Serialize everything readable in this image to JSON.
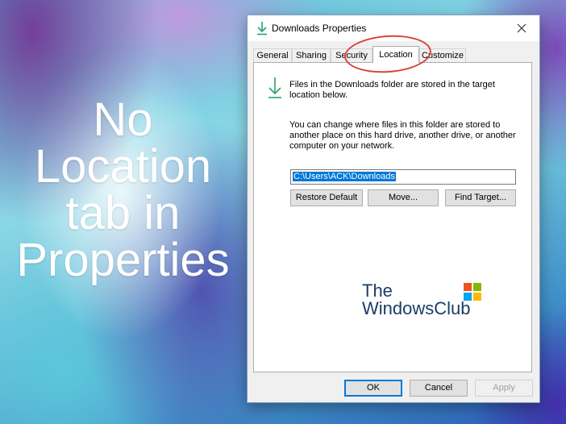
{
  "overlay_text": {
    "line1": "No",
    "line2": "Location",
    "line3": "tab in",
    "line4": "Properties"
  },
  "dialog": {
    "title": "Downloads Properties",
    "close_label": "✕",
    "tabs": [
      {
        "label": "General"
      },
      {
        "label": "Sharing"
      },
      {
        "label": "Security"
      },
      {
        "label": "Location"
      },
      {
        "label": "Customize"
      }
    ],
    "active_tab": "Location",
    "panel": {
      "info_text": "Files in the Downloads folder are stored in the target location below.",
      "change_text": "You can change where files in this folder are stored to another place on this hard drive, another drive, or another computer on your network.",
      "path_value": "C:\\Users\\ACK\\Downloads",
      "restore_default_label": "Restore Default",
      "move_label": "Move...",
      "find_target_label": "Find Target...",
      "watermark_line1": "The",
      "watermark_line2": "WindowsClub"
    },
    "ok_label": "OK",
    "cancel_label": "Cancel",
    "apply_label": "Apply"
  },
  "colors": {
    "accent": "#0078d7",
    "annotation": "#d8433a",
    "download_icon": "#2aa06c"
  },
  "icons": {
    "title_icon": "download-arrow-icon",
    "panel_icon": "download-arrow-icon",
    "watermark_logo": "windows-logo-icon"
  }
}
